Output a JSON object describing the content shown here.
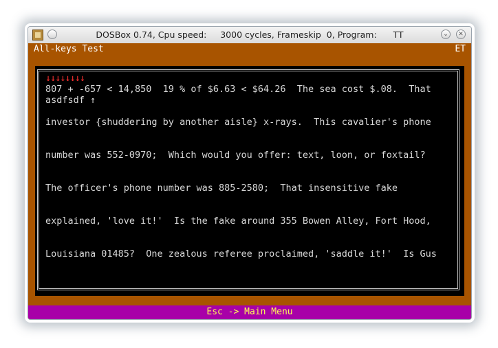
{
  "window": {
    "title": "DOSBox 0.74, Cpu speed:     3000 cycles, Frameskip  0, Program:      TT",
    "icon": "dosbox-icon",
    "menu_button_icon": "circle-icon",
    "minimize_icon": "chevron-down-icon",
    "close_icon": "close-icon"
  },
  "screen": {
    "header_title": "All-keys Test",
    "header_right": "ET",
    "lines": [
      "↓↓↓↓↓↓↓↓",
      "807 + -657 < 14,850  19 % of $6.63 < $64.26  The sea cost $.08.  That",
      "asdfsdf ↑",
      "investor {shuddering by another aisle} x-rays.  This cavalier's phone",
      "number was 552-0970;  Which would you offer: text, loon, or foxtail?",
      "The officer's phone number was 885-2580;  That insensitive fake",
      "explained, 'love it!'  Is the fake around 355 Bowen Alley, Fort Hood,",
      "Louisiana 01485?  One zealous referee proclaimed, 'saddle it!'  Is Gus"
    ],
    "footer": "Esc -> Main Menu"
  },
  "colors": {
    "background": "#a85400",
    "panel": "#000000",
    "text": "#d8d8d8",
    "arrows": "#ff3030",
    "footer_bar": "#a800a8",
    "footer_text": "#ffff55"
  }
}
